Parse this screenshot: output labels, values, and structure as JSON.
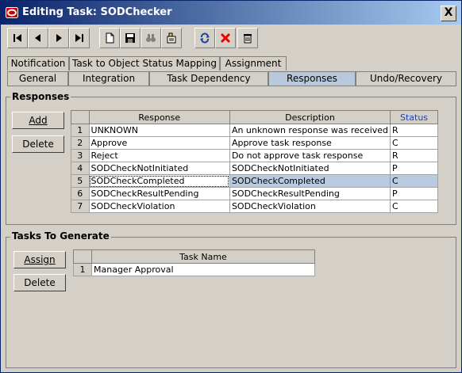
{
  "window": {
    "title": "Editing Task: SODChecker",
    "close_label": "X"
  },
  "toolbar": {
    "buttons": [
      {
        "name": "first-record",
        "icon": "first-icon"
      },
      {
        "name": "previous-record",
        "icon": "prev-icon"
      },
      {
        "name": "next-record",
        "icon": "next-icon"
      },
      {
        "name": "last-record",
        "icon": "last-icon"
      },
      {
        "name": "new",
        "icon": "new-document-icon"
      },
      {
        "name": "save",
        "icon": "save-icon"
      },
      {
        "name": "find",
        "icon": "binoculars-icon"
      },
      {
        "name": "properties",
        "icon": "properties-icon"
      },
      {
        "name": "refresh",
        "icon": "refresh-icon"
      },
      {
        "name": "cancel",
        "icon": "red-x-icon"
      },
      {
        "name": "delete",
        "icon": "trash-icon"
      }
    ]
  },
  "tabs_top": [
    "Notification",
    "Task to Object Status Mapping",
    "Assignment"
  ],
  "tabs_bottom": [
    "General",
    "Integration",
    "Task Dependency",
    "Responses",
    "Undo/Recovery"
  ],
  "active_tab": "Responses",
  "responses": {
    "title": "Responses",
    "add_label": "Add",
    "delete_label": "Delete",
    "columns": [
      "Response",
      "Description",
      "Status"
    ],
    "rows": [
      {
        "num": "1",
        "response": "UNKNOWN",
        "description": "An unknown response was received",
        "status": "R"
      },
      {
        "num": "2",
        "response": "Approve",
        "description": "Approve task response",
        "status": "C"
      },
      {
        "num": "3",
        "response": "Reject",
        "description": "Do not approve task response",
        "status": "R"
      },
      {
        "num": "4",
        "response": "SODCheckNotInitiated",
        "description": "SODCheckNotInitiated",
        "status": "P"
      },
      {
        "num": "5",
        "response": "SODCheckCompleted",
        "description": "SODCheckCompleted",
        "status": "C"
      },
      {
        "num": "6",
        "response": "SODCheckResultPending",
        "description": "SODCheckResultPending",
        "status": "P"
      },
      {
        "num": "7",
        "response": "SODCheckViolation",
        "description": "SODCheckViolation",
        "status": "C"
      }
    ],
    "selected_row": 5
  },
  "tasks_to_generate": {
    "title": "Tasks To Generate",
    "assign_label": "Assign",
    "delete_label": "Delete",
    "columns": [
      "Task Name"
    ],
    "rows": [
      {
        "num": "1",
        "task": "Manager Approval"
      }
    ]
  },
  "colors": {
    "title_start": "#0a246a",
    "title_end": "#a6caf0",
    "selection": "#b9cbe0",
    "active_tab": "#b9c9dd"
  }
}
